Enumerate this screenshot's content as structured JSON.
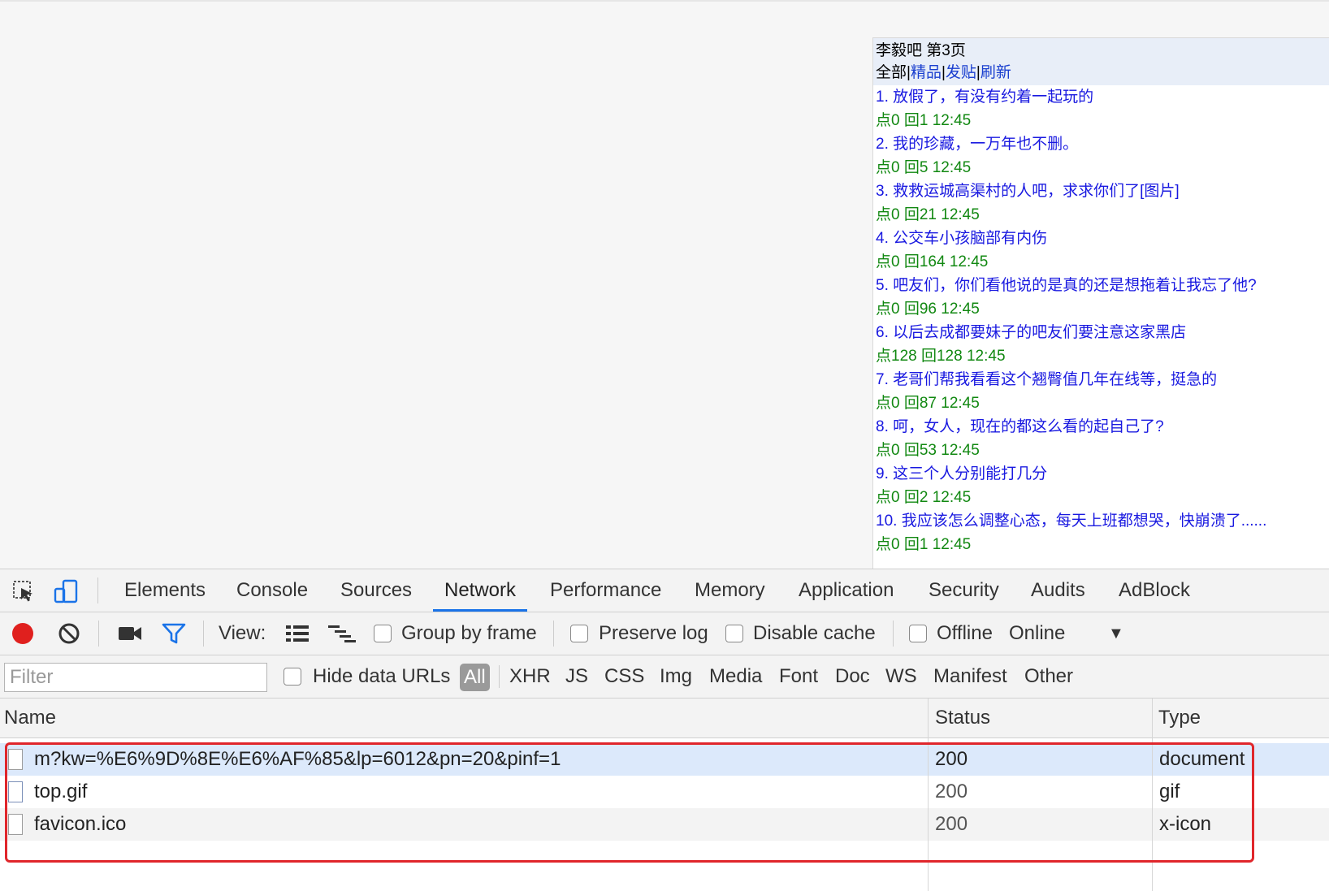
{
  "page_panel": {
    "title": "李毅吧 第3页",
    "nav": {
      "all": "全部",
      "links": [
        "精品",
        "发贴",
        "刷新"
      ],
      "separator": "|"
    },
    "posts": [
      {
        "title": "1. 放假了，有没有约着一起玩的",
        "meta": "点0 回1 12:45"
      },
      {
        "title": "2. 我的珍藏，一万年也不删。",
        "meta": "点0 回5 12:45"
      },
      {
        "title": "3. 救救运城高渠村的人吧，求求你们了[图片]",
        "meta": "点0 回21 12:45"
      },
      {
        "title": "4. 公交车小孩脑部有内伤",
        "meta": "点0 回164 12:45"
      },
      {
        "title": "5. 吧友们，你们看他说的是真的还是想拖着让我忘了他?",
        "meta": "点0 回96 12:45"
      },
      {
        "title": "6. 以后去成都要妹子的吧友们要注意这家黑店",
        "meta": "点128 回128 12:45"
      },
      {
        "title": "7. 老哥们帮我看看这个翘臀值几年在线等，挺急的",
        "meta": "点0 回87 12:45"
      },
      {
        "title": "8. 呵，女人，现在的都这么看的起自己了?",
        "meta": "点0 回53 12:45"
      },
      {
        "title": "9. 这三个人分别能打几分",
        "meta": "点0 回2 12:45"
      },
      {
        "title": "10. 我应该怎么调整心态，每天上班都想哭，快崩溃了......",
        "meta": "点0 回1 12:45"
      }
    ]
  },
  "devtools": {
    "tabs": [
      "Elements",
      "Console",
      "Sources",
      "Network",
      "Performance",
      "Memory",
      "Application",
      "Security",
      "Audits",
      "AdBlock"
    ],
    "active_tab": "Network",
    "toolbar": {
      "view_label": "View:",
      "group_by_frame": "Group by frame",
      "preserve_log": "Preserve log",
      "disable_cache": "Disable cache",
      "offline": "Offline",
      "throttle_value": "Online",
      "dropdown_glyph": "▼"
    },
    "filter": {
      "placeholder": "Filter",
      "hide_data_urls": "Hide data URLs",
      "types": [
        "All",
        "XHR",
        "JS",
        "CSS",
        "Img",
        "Media",
        "Font",
        "Doc",
        "WS",
        "Manifest",
        "Other"
      ]
    },
    "columns": [
      "Name",
      "Status",
      "Type"
    ],
    "requests": [
      {
        "name": "m?kw=%E6%9D%8E%E6%AF%85&lp=6012&pn=20&pinf=1",
        "status": "200",
        "type": "document"
      },
      {
        "name": "top.gif",
        "status": "200",
        "type": "gif"
      },
      {
        "name": "favicon.ico",
        "status": "200",
        "type": "x-icon"
      }
    ]
  },
  "colors": {
    "record": "#e0201e",
    "accent_blue": "#1a73e8",
    "selected_row": "#dce9fb",
    "highlight_box": "#e0262b",
    "link_blue": "#1919e0",
    "meta_green": "#118811"
  }
}
